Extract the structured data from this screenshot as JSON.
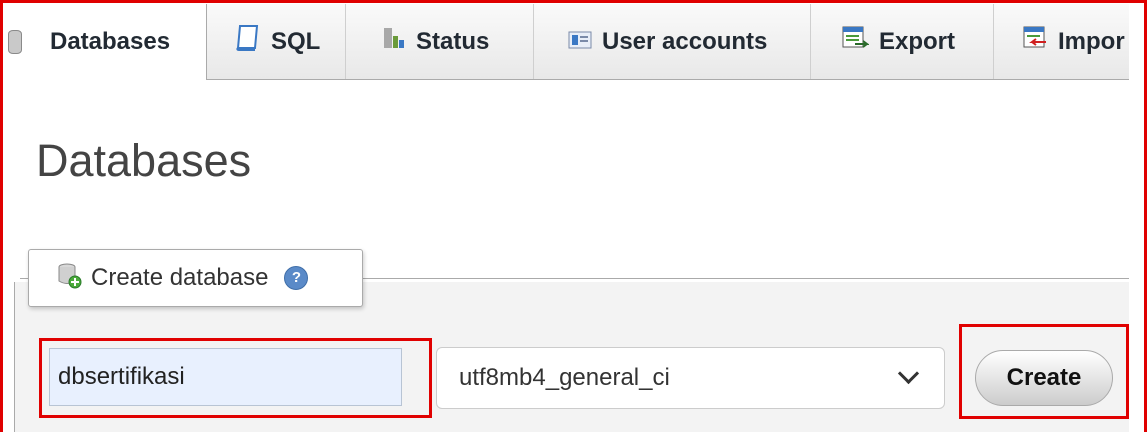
{
  "tabs": [
    {
      "label": "Databases",
      "icon": "database-icon",
      "active": true
    },
    {
      "label": "SQL",
      "icon": "sql-icon",
      "active": false
    },
    {
      "label": "Status",
      "icon": "status-chart-icon",
      "active": false
    },
    {
      "label": "User accounts",
      "icon": "user-accounts-icon",
      "active": false
    },
    {
      "label": "Export",
      "icon": "export-icon",
      "active": false
    },
    {
      "label": "Impor",
      "icon": "import-icon",
      "active": false
    }
  ],
  "page_title": "Databases",
  "create_section": {
    "legend": "Create database",
    "legend_icon": "create-database-icon",
    "help_glyph": "?",
    "db_name_value": "dbsertifikasi",
    "collation_selected": "utf8mb4_general_ci",
    "create_button": "Create"
  },
  "colors": {
    "highlight": "#e00000",
    "autofill_bg": "#e8f0fe",
    "help_icon": "#5a8ac8"
  }
}
